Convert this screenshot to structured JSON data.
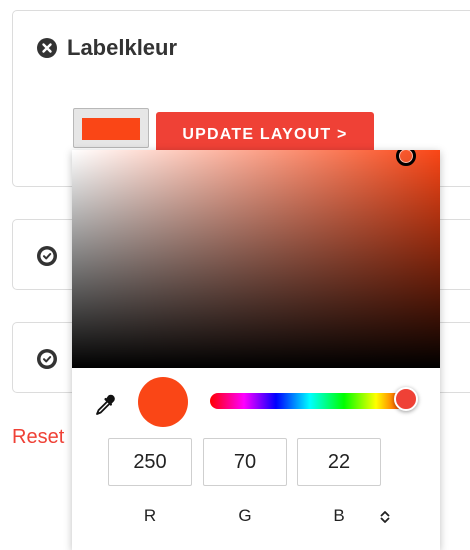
{
  "card_label": {
    "title": "Labelkleur",
    "title_icon": "circle-x-icon",
    "swatch_color": "#fa4616",
    "update_button_label": "UPDATE LAYOUT >"
  },
  "card_2": {
    "icon": "circle-check-icon"
  },
  "card_3": {
    "icon": "circle-check-icon"
  },
  "reset_label": "Reset",
  "picker": {
    "current_color": "#fa4616",
    "hue_color": "#ef4136",
    "eyedropper_icon": "eyedropper-icon",
    "mode_toggle_icon": "chevron-up-down-icon",
    "r": "250",
    "g": "70",
    "b": "22",
    "r_label": "R",
    "g_label": "G",
    "b_label": "B"
  },
  "colors": {
    "accent": "#ef4136",
    "text": "#222222",
    "border": "#dcdcdc"
  }
}
